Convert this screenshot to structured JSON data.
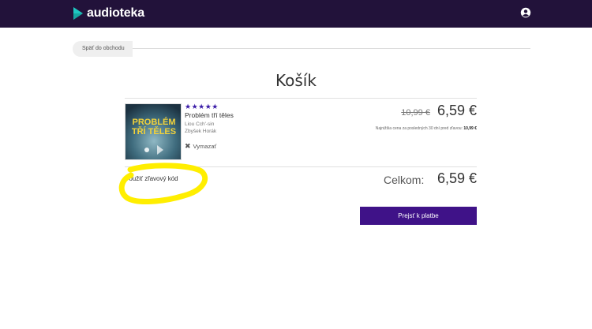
{
  "header": {
    "brand": "audioteka"
  },
  "nav": {
    "back_label": "Späť do obchodu"
  },
  "page": {
    "title": "Košík"
  },
  "cart_item": {
    "rating_stars": "★★★★★",
    "title": "Problém tří těles",
    "author": "Liou Cch'-sin",
    "narrator": "Zbyšek Horák",
    "remove_label": "Vymazať",
    "old_price": "10,99 €",
    "new_price": "6,59 €",
    "lowest_price_note": "Najnižšia cena za posledných 30 dní pred zľavou:",
    "lowest_price_value": "10,99 €",
    "cover": {
      "line1": "PROBLÉM",
      "line2": "TŘÍ TĚLES"
    }
  },
  "discount": {
    "label": "Použiť zľavový kód"
  },
  "total": {
    "label": "Celkom:",
    "value": "6,59 €"
  },
  "checkout": {
    "label": "Prejsť k platbe"
  },
  "colors": {
    "header_bg": "#22123a",
    "accent": "#3f1288",
    "star": "#3b1da8",
    "logo_play": "#1fc7c1",
    "highlight": "#ffee00"
  }
}
